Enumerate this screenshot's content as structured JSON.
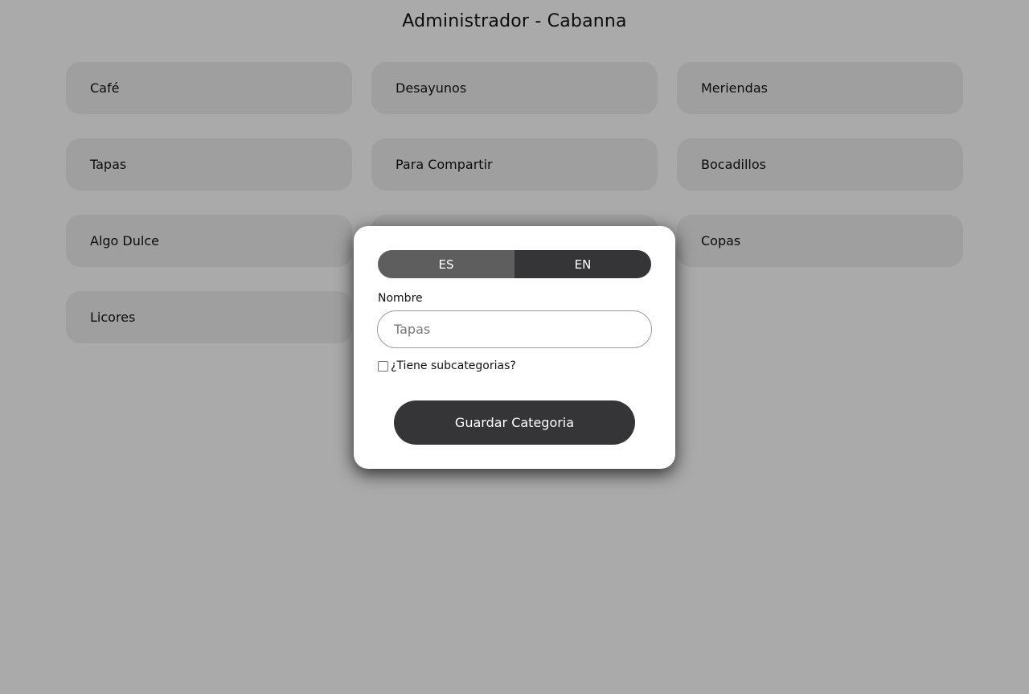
{
  "header": {
    "title": "Administrador - Cabanna"
  },
  "categories": [
    {
      "label": "Café"
    },
    {
      "label": "Desayunos"
    },
    {
      "label": "Meriendas"
    },
    {
      "label": "Tapas"
    },
    {
      "label": "Para Compartir"
    },
    {
      "label": "Bocadillos"
    },
    {
      "label": "Algo Dulce"
    },
    {
      "label": ""
    },
    {
      "label": "Copas"
    },
    {
      "label": "Licores"
    }
  ],
  "modal": {
    "lang_tabs": [
      {
        "label": "ES",
        "active": true
      },
      {
        "label": "EN",
        "active": false
      }
    ],
    "name_label": "Nombre",
    "name_placeholder": "Tapas",
    "name_value": "",
    "subcategories_label": "¿Tiene subcategorias?",
    "subcategories_checked": false,
    "save_label": "Guardar Categoria"
  },
  "colors": {
    "overlay": "rgba(0,0,0,0.335)",
    "card_bg": "#efefef",
    "button_dark": "#353537",
    "tab_active": "#5e5e5e"
  }
}
